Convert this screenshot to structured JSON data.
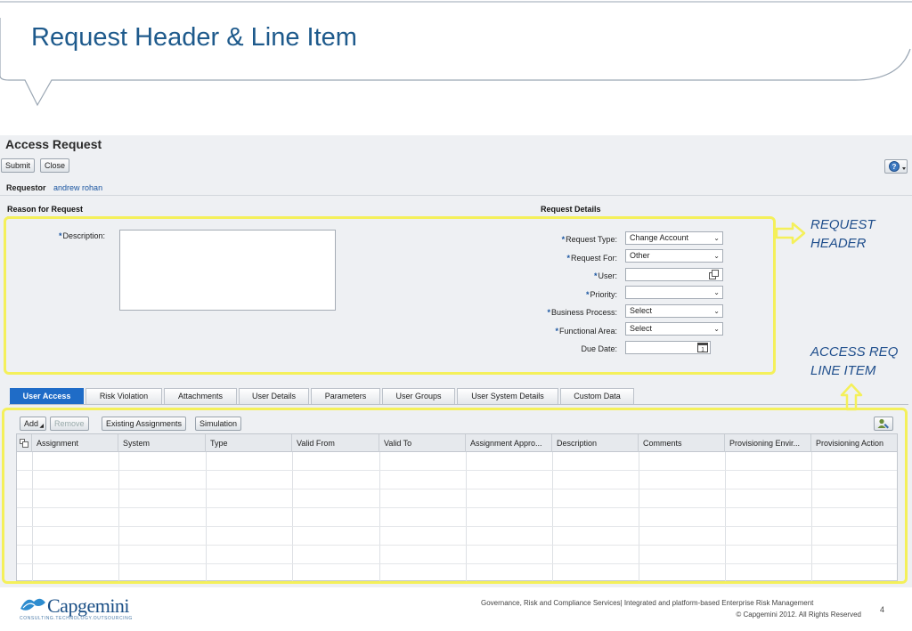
{
  "slide": {
    "title": "Request Header & Line Item",
    "footer_line1": "Governance, Risk and Compliance Services| Integrated and platform-based Enterprise Risk Management",
    "footer_line2": "© Capgemini 2012. All Rights Reserved",
    "page_number": "4",
    "logo_name": "Capgemini",
    "logo_tagline": "CONSULTING.TECHNOLOGY.OUTSOURCING"
  },
  "app": {
    "title": "Access Request",
    "toolbar": {
      "submit_label": "Submit",
      "close_label": "Close"
    },
    "requestor": {
      "label": "Requestor",
      "value": "andrew rohan"
    },
    "reason_section": {
      "title": "Reason for Request",
      "description_label": "Description:"
    },
    "details_section": {
      "title": "Request Details",
      "request_type_label": "Request Type:",
      "request_type_value": "Change Account",
      "request_for_label": "Request For:",
      "request_for_value": "Other",
      "user_label": "User:",
      "user_value": "",
      "priority_label": "Priority:",
      "priority_value": "",
      "business_process_label": "Business Process:",
      "business_process_value": "Select",
      "functional_area_label": "Functional Area:",
      "functional_area_value": "Select",
      "due_date_label": "Due Date:",
      "due_date_value": ""
    },
    "tabs": [
      {
        "label": "User Access",
        "active": true
      },
      {
        "label": "Risk Violation"
      },
      {
        "label": "Attachments"
      },
      {
        "label": "User Details"
      },
      {
        "label": "Parameters"
      },
      {
        "label": "User Groups"
      },
      {
        "label": "User System Details"
      },
      {
        "label": "Custom Data"
      }
    ],
    "line_toolbar": {
      "add_label": "Add",
      "remove_label": "Remove",
      "existing_assignments_label": "Existing Assignments",
      "simulation_label": "Simulation"
    },
    "table": {
      "columns": [
        "Assignment",
        "System",
        "Type",
        "Valid From",
        "Valid To",
        "Assignment Appro...",
        "Description",
        "Comments",
        "Provisioning Envir...",
        "Provisioning Action"
      ],
      "rows": []
    }
  },
  "annotations": {
    "header_label": "REQUEST HEADER",
    "line_item_label": "ACCESS REQ LINE ITEM",
    "highlight_color": "#f4f05a",
    "annotation_color": "#1f4e8c"
  }
}
